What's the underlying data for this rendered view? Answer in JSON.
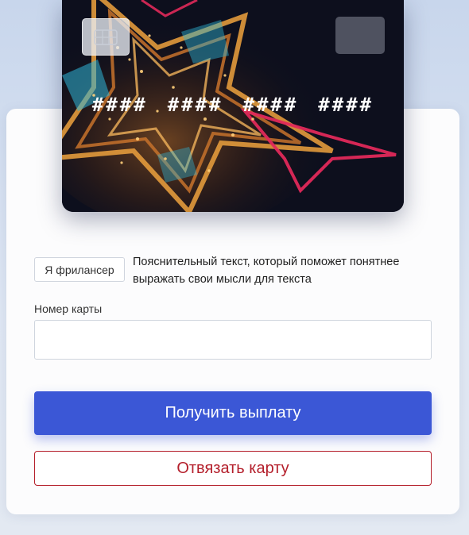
{
  "card": {
    "number_groups": [
      "####",
      "####",
      "####",
      "####"
    ],
    "left_chip_icon": "chip-icon",
    "accent_colors": [
      "#e0295a",
      "#2fb6d8",
      "#e29a3c"
    ]
  },
  "info": {
    "badge": "Я фрилансер",
    "hint": "Пояснительный текст, который поможет понятнее выражать свои мысли для текста"
  },
  "form": {
    "card_label": "Номер карты",
    "card_value": ""
  },
  "buttons": {
    "payout": "Получить выплату",
    "unlink": "Отвязать карту"
  },
  "colors": {
    "primary": "#3b57d6",
    "danger": "#b41f2b"
  }
}
